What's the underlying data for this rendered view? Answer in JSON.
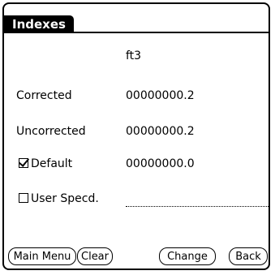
{
  "title": "Indexes",
  "units": "ft3",
  "rows": {
    "corrected": {
      "label": "Corrected",
      "value": "00000000.2"
    },
    "uncorrected": {
      "label": "Uncorrected",
      "value": "00000000.2"
    },
    "default": {
      "label": "Default",
      "value": "00000000.0",
      "checked": true
    },
    "user_specd": {
      "label": "User Specd.",
      "value": "",
      "checked": false
    }
  },
  "buttons": {
    "main_menu": "Main Menu",
    "clear": "Clear",
    "change": "Change",
    "back": "Back"
  }
}
